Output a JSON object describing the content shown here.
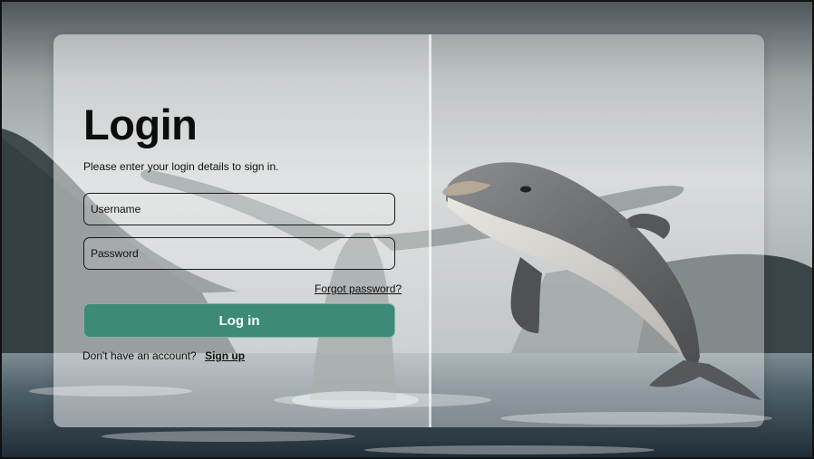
{
  "login": {
    "title": "Login",
    "subtitle": "Please enter your login details to sign in.",
    "username_placeholder": "Username",
    "password_placeholder": "Password",
    "forgot_label": "Forgot password?",
    "submit_label": "Log in",
    "no_account_text": "Don't have an account?",
    "signup_label": "Sign up"
  },
  "colors": {
    "accent": "#3d8a76",
    "text": "#111111",
    "field_border": "#1a1a1a"
  },
  "images": {
    "background": "whale-tail-ocean",
    "hero": "leaping-dolphin"
  }
}
